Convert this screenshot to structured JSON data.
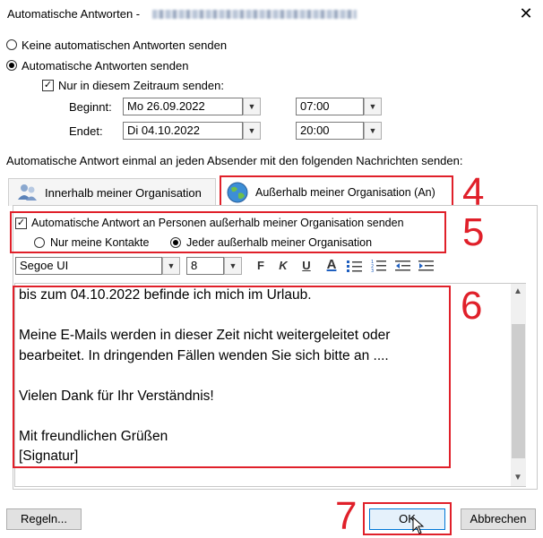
{
  "window": {
    "title": "Automatische Antworten -",
    "close_glyph": "✕"
  },
  "options": {
    "none_label": "Keine automatischen Antworten senden",
    "send_label": "Automatische Antworten senden",
    "timeframe_label": "Nur in diesem Zeitraum senden:",
    "start_label": "Beginnt:",
    "start_date": "Mo 26.09.2022",
    "start_time": "07:00",
    "end_label": "Endet:",
    "end_date": "Di 04.10.2022",
    "end_time": "20:00"
  },
  "description": "Automatische Antwort einmal an jeden Absender mit den folgenden Nachrichten senden:",
  "tabs": [
    {
      "label": "Innerhalb meiner Organisation"
    },
    {
      "label": "Außerhalb meiner Organisation (An)"
    }
  ],
  "outside": {
    "checkbox_label": "Automatische Antwort an Personen außerhalb meiner Organisation senden",
    "contacts_label": "Nur meine Kontakte",
    "everyone_label": "Jeder außerhalb meiner Organisation"
  },
  "toolbar": {
    "font": "Segoe UI",
    "size": "8",
    "bold": "F",
    "italic": "K",
    "underline": "U",
    "fontcolor": "A"
  },
  "message": {
    "lines": [
      "bis zum 04.10.2022 befinde ich mich im Urlaub.",
      "",
      "Meine E-Mails werden in dieser Zeit nicht weitergeleitet oder",
      "bearbeitet. In dringenden Fällen wenden Sie sich bitte an ....",
      "",
      "Vielen Dank für Ihr Verständnis!",
      "",
      "Mit freundlichen Grüßen",
      "[Signatur]"
    ]
  },
  "annotations": {
    "n4": "4",
    "n5": "5",
    "n6": "6",
    "n7": "7"
  },
  "buttons": {
    "rules": "Regeln...",
    "ok": "OK",
    "cancel": "Abbrechen"
  },
  "colors": {
    "annotation_red": "#e0202a",
    "dialog_bg": "#ffffff"
  }
}
